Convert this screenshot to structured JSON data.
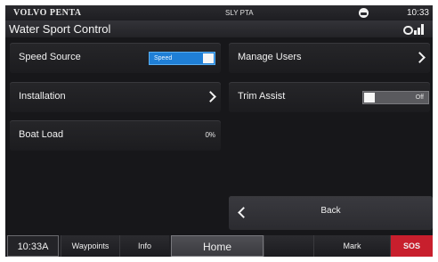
{
  "status": {
    "brand": "VOLVO PENTA",
    "vessel": "SLY PTA",
    "clock": "10:33"
  },
  "header": {
    "title": "Water Sport Control"
  },
  "settings": {
    "speed_source": {
      "label": "Speed Source",
      "value": "Speed",
      "on": true
    },
    "manage_users": {
      "label": "Manage Users"
    },
    "installation": {
      "label": "Installation"
    },
    "trim_assist": {
      "label": "Trim Assist",
      "value": "Off",
      "on": false
    },
    "boat_load": {
      "label": "Boat Load",
      "value": "0%"
    },
    "back": {
      "label": "Back"
    }
  },
  "nav": {
    "time": "10:33A",
    "waypoints": "Waypoints",
    "info": "Info",
    "home": "Home",
    "mark": "Mark",
    "sos": "SOS"
  },
  "colors": {
    "accent": "#1f7fd6",
    "sos": "#c81f2d",
    "background": "#17171a"
  }
}
